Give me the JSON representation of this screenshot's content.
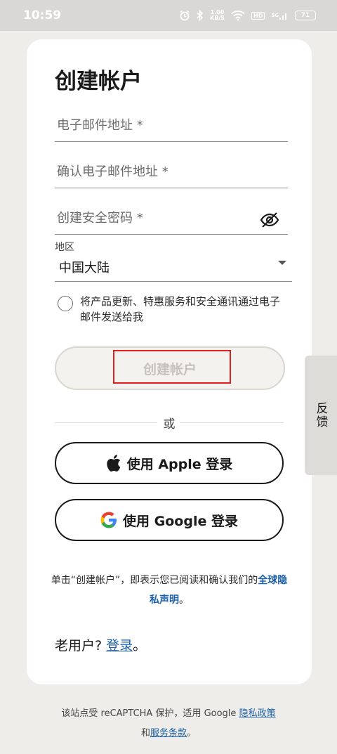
{
  "status_bar": {
    "time": "10:59",
    "net_speed_value": "1.00",
    "net_speed_unit": "KB/S",
    "hd_label": "HD",
    "signal_label": "5G",
    "battery": "71"
  },
  "form": {
    "title": "创建帐户",
    "email_placeholder": "电子邮件地址 *",
    "confirm_email_placeholder": "确认电子邮件地址 *",
    "password_placeholder": "创建安全密码 *",
    "region_label": "地区",
    "region_value": "中国大陆",
    "consent_text": "将产品更新、特惠服务和安全通讯通过电子邮件发送给我",
    "create_button": "创建帐户",
    "divider_text": "或",
    "apple_button": "使用 Apple 登录",
    "google_button": "使用 Google 登录"
  },
  "legal": {
    "prefix": "单击“创建帐户”，即表示您已阅读和确认我们的",
    "link": "全球隐私声明",
    "suffix": "。"
  },
  "returning": {
    "prefix": "老用户?",
    "link": "登录",
    "suffix": "。"
  },
  "footer": {
    "prefix": "该站点受 reCAPTCHA 保护，适用 Google",
    "privacy_link": "隐私政策",
    "and": "和",
    "terms_link": "服务条款",
    "suffix": "。"
  },
  "feedback": {
    "label": "反馈"
  },
  "colors": {
    "link": "#1a5fa8",
    "highlight": "#e02020",
    "background": "#efedea"
  }
}
